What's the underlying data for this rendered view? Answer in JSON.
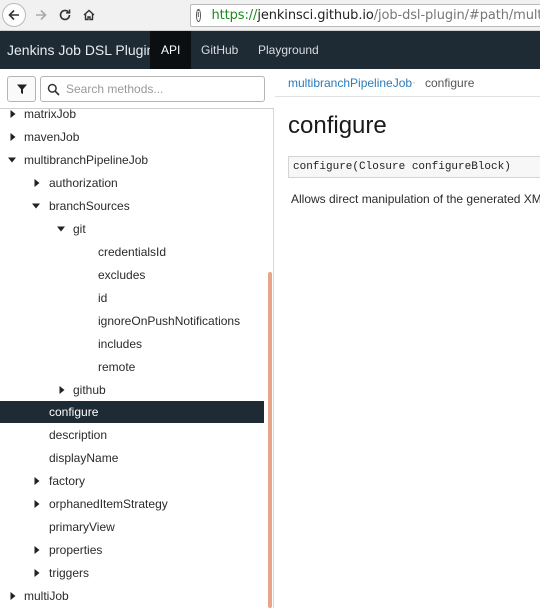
{
  "browser": {
    "url_scheme": "https://",
    "url_host": "jenkinsci.github.io",
    "url_path": "/job-dsl-plugin/#path/multibranch",
    "info_glyph": "i"
  },
  "navbar": {
    "brand": "Jenkins Job DSL Plugin",
    "items": [
      {
        "label": "API",
        "active": true
      },
      {
        "label": "GitHub",
        "active": false
      },
      {
        "label": "Playground",
        "active": false
      }
    ],
    "active_bg": "#0b0f12",
    "bg": "#1e2a34"
  },
  "sidebar": {
    "search_placeholder": "Search methods...",
    "filter_icon": "filter-icon",
    "search_icon": "search-icon",
    "items": [
      {
        "label": "matrixJob",
        "expanded": false
      },
      {
        "label": "mavenJob",
        "expanded": false
      },
      {
        "label": "multibranchPipelineJob",
        "expanded": true
      },
      {
        "label": "authorization",
        "expanded": false
      },
      {
        "label": "branchSources",
        "expanded": true
      },
      {
        "label": "git",
        "expanded": true
      },
      {
        "label": "credentialsId"
      },
      {
        "label": "excludes"
      },
      {
        "label": "id"
      },
      {
        "label": "ignoreOnPushNotifications"
      },
      {
        "label": "includes"
      },
      {
        "label": "remote"
      },
      {
        "label": "github",
        "expanded": false
      },
      {
        "label": "configure",
        "selected": true
      },
      {
        "label": "description"
      },
      {
        "label": "displayName"
      },
      {
        "label": "factory",
        "expanded": false
      },
      {
        "label": "orphanedItemStrategy",
        "expanded": false
      },
      {
        "label": "primaryView"
      },
      {
        "label": "properties",
        "expanded": false
      },
      {
        "label": "triggers",
        "expanded": false
      },
      {
        "label": "multiJob",
        "expanded": false
      }
    ]
  },
  "breadcrumb": {
    "parent": "multibranchPipelineJob",
    "separator": "·",
    "current": "configure"
  },
  "main": {
    "title": "configure",
    "signature": "configure(Closure configureBlock)",
    "description": "Allows direct manipulation of the generated XML."
  },
  "colors": {
    "link": "#2b7bb9",
    "scrollbar": "#e8a58a",
    "selected_bg": "#1e2a34"
  }
}
